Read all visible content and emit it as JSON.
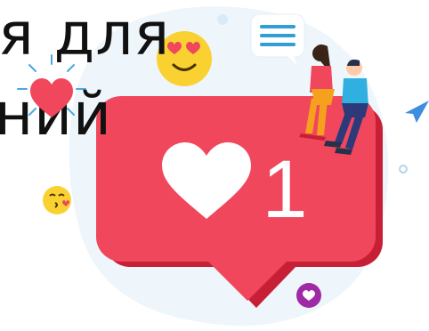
{
  "headline": {
    "line1": "я для",
    "line2": "ний"
  },
  "notification": {
    "count": "1",
    "icon": "heart-icon",
    "color": "#f0475d"
  },
  "decorations": {
    "emojis": [
      "heart-eyes-emoji-icon",
      "kiss-emoji-icon",
      "heart-icon"
    ],
    "chat_icon": "chat-bubble-menu-icon",
    "paper_plane_icon": "paper-plane-icon",
    "badge_icon": "heart-badge-icon"
  },
  "colors": {
    "accent": "#f0475d",
    "accent_dark": "#d3263d",
    "blob": "#eaf4fb",
    "blue": "#2f9fd6",
    "yellow": "#f9d232"
  }
}
